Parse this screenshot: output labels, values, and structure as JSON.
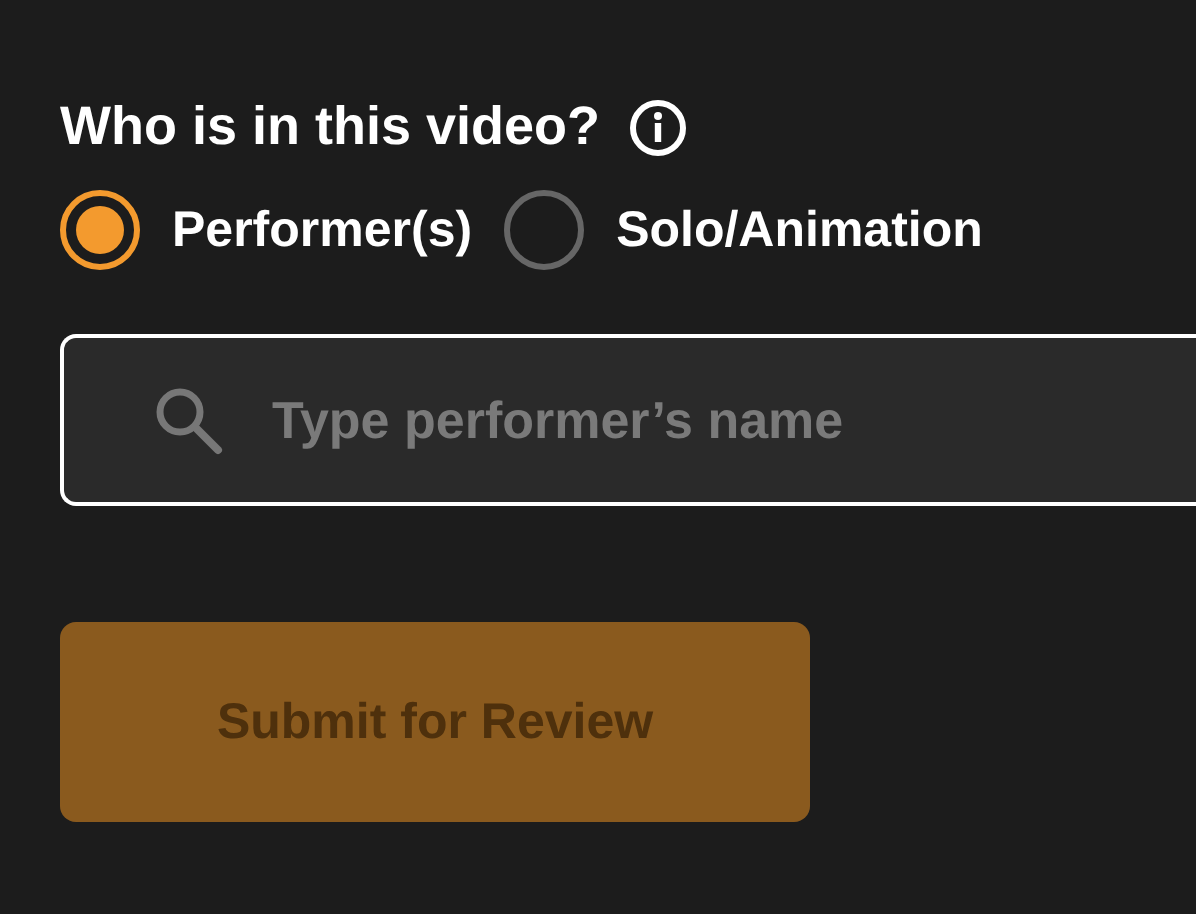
{
  "question": {
    "label": "Who is in this video?"
  },
  "options": [
    {
      "label": "Performer(s)",
      "selected": true
    },
    {
      "label": "Solo/Animation",
      "selected": false
    }
  ],
  "search": {
    "placeholder": "Type performer’s name"
  },
  "submit": {
    "label": "Submit for Review",
    "disabled": true
  }
}
